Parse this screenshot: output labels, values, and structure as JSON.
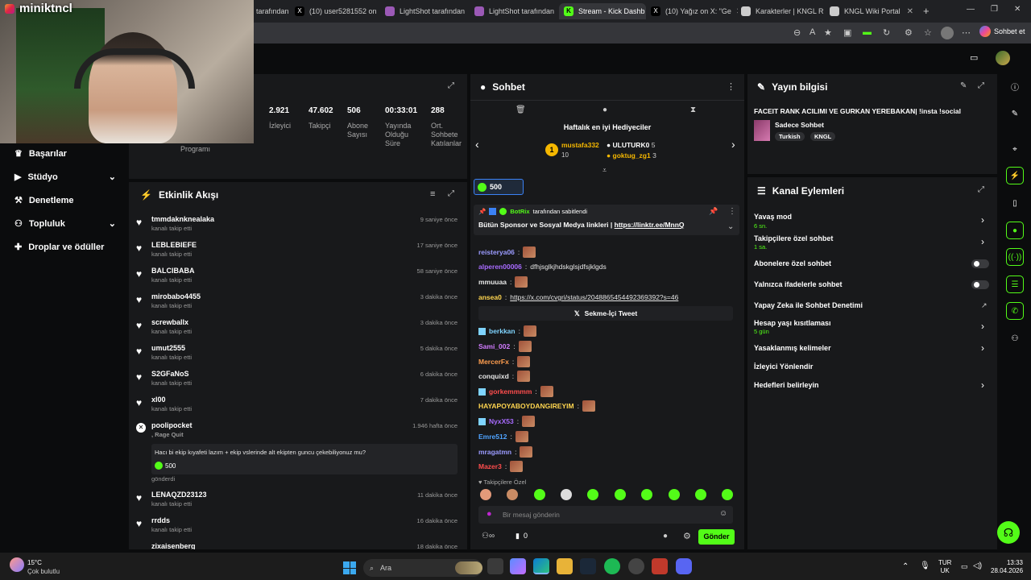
{
  "browser": {
    "tabs": [
      {
        "label": "tarafından",
        "active": false
      },
      {
        "label": "(10) user5281552 on",
        "active": false
      },
      {
        "label": "LightShot tarafından",
        "active": false
      },
      {
        "label": "LightShot tarafından",
        "active": false
      },
      {
        "label": "Stream - Kick Dashb",
        "active": true
      },
      {
        "label": "(10) Yağız on X: \"Ge",
        "active": false
      },
      {
        "label": "Karakterler | KNGL R",
        "active": false
      },
      {
        "label": "KNGL Wiki Portal",
        "active": false
      }
    ],
    "chat_button": "Sohbet et"
  },
  "webcam": {
    "username": "miniktncl"
  },
  "sidebar": {
    "items": [
      {
        "label": "Başarılar",
        "icon": "trophy-icon"
      },
      {
        "label": "Stüdyo",
        "icon": "video-icon",
        "expandable": true
      },
      {
        "label": "Denetleme",
        "icon": "hammer-icon"
      },
      {
        "label": "Topluluk",
        "icon": "people-icon",
        "expandable": true
      },
      {
        "label": "Droplar ve ödüller",
        "icon": "gift-icon"
      }
    ]
  },
  "stats": {
    "partial_label": "Programı",
    "items": [
      {
        "value": "2.921",
        "label": "İzleyici"
      },
      {
        "value": "47.602",
        "label": "Takipçi"
      },
      {
        "value": "506",
        "label": "Abone Sayısı"
      },
      {
        "value": "00:33:01",
        "label": "Yayında Olduğu Süre"
      },
      {
        "value": "288",
        "label": "Ort. Sohbete Katılanlar"
      }
    ]
  },
  "activity": {
    "title": "Etkinlik Akışı",
    "events": [
      {
        "name": "tmmdaknknealaka",
        "sub": "kanalı takip etti",
        "time": "9 saniye önce"
      },
      {
        "name": "LEBLEBIEFE",
        "sub": "kanalı takip etti",
        "time": "17 saniye önce"
      },
      {
        "name": "BALCIBABA",
        "sub": "kanalı takip etti",
        "time": "58 saniye önce"
      },
      {
        "name": "mirobabo4455",
        "sub": "kanalı takip etti",
        "time": "3 dakika önce"
      },
      {
        "name": "screwballx",
        "sub": "kanalı takip etti",
        "time": "3 dakika önce"
      },
      {
        "name": "umut2555",
        "sub": "kanalı takip etti",
        "time": "5 dakika önce"
      },
      {
        "name": "S2GFaNoS",
        "sub": "kanalı takip etti",
        "time": "6 dakika önce"
      },
      {
        "name": "xl00",
        "sub": "kanalı takip etti",
        "time": "7 dakika önce"
      }
    ],
    "gift": {
      "name": "poolipocket",
      "sub": ", Rage Quit",
      "time": "1.946 hafta önce",
      "message": "Hacı bi ekip kıyafeti lazım + ekip vslerinde alt ekipten guncu çekebiliyonuz mu?",
      "amount": "500",
      "footer": "gönderdi"
    },
    "events2": [
      {
        "name": "LENAQZD23123",
        "sub": "kanalı takip etti",
        "time": "11 dakika önce"
      },
      {
        "name": "rrdds",
        "sub": "kanalı takip etti",
        "time": "16 dakika önce"
      },
      {
        "name": "zixaisenberg",
        "sub": "",
        "time": "18 dakika önce"
      }
    ]
  },
  "chat": {
    "title": "Sohbet",
    "gifters_title": "Haftalık en iyi Hediyeciler",
    "gifters": [
      {
        "name": "mustafa332",
        "count": "10"
      },
      {
        "name": "ULUTURK0",
        "count": "5"
      },
      {
        "name": "goktug_zg1",
        "count": "3"
      }
    ],
    "kicks_badge": "500",
    "pinned": {
      "by": "BotRix",
      "by_suffix": "tarafından sabitlendi",
      "text": "Bütün Sponsor ve Sosyal Medya linkleri |",
      "link": "https://linktr.ee/MnnQ"
    },
    "messages": [
      {
        "user": "reisterya06",
        "color": "#9b9bff",
        "text": ""
      },
      {
        "user": "alperen00006",
        "color": "#a86bff",
        "text": "dfhjsglkjhdskglsjdfsjklgds"
      },
      {
        "user": "mmuuaa",
        "color": "#e6e6e6",
        "text": ""
      },
      {
        "user": "ansea0",
        "color": "#ffd54f",
        "text": "https://x.com/cvgri/status/2048865454492369392?s=46"
      }
    ],
    "tweet_label": "Sekme-İçi Tweet",
    "messages2": [
      {
        "user": "berkkan",
        "color": "#7fd4ff"
      },
      {
        "user": "Sami_002",
        "color": "#d17bff"
      },
      {
        "user": "MercerFx",
        "color": "#ff9e4f"
      },
      {
        "user": "conquixd",
        "color": "#e6e6e6"
      },
      {
        "user": "gorkemmmm",
        "color": "#ff4d4d"
      },
      {
        "user": "HAYAPOYABOYDANGIREYIM",
        "color": "#ffd54f"
      },
      {
        "user": "NyxX53",
        "color": "#a86bff"
      },
      {
        "user": "Emre512",
        "color": "#4fa3ff"
      },
      {
        "user": "mragatmn",
        "color": "#9b9bff"
      },
      {
        "user": "Mazer3",
        "color": "#ff4d4d"
      }
    ],
    "followers_only": "Takipçilere Özel",
    "input_placeholder": "Bir mesaj gönderin",
    "points": "0",
    "send_label": "Gönder"
  },
  "stream_info": {
    "title": "Yayın bilgisi",
    "stream_title": "FACEIT RANK ACILIMI VE GURKAN YEREBAKAN| !insta !social",
    "category": "Sadece Sohbet",
    "tags": [
      "Turkish",
      "KNGL"
    ]
  },
  "channel_actions": {
    "title": "Kanal Eylemleri",
    "items": [
      {
        "label": "Yavaş mod",
        "sub": "6 sn.",
        "control": "chevron"
      },
      {
        "label": "Takipçilere özel sohbet",
        "sub": "1 sa.",
        "control": "chevron"
      },
      {
        "label": "Abonelere özel sohbet",
        "sub": "",
        "control": "toggle"
      },
      {
        "label": "Yalnızca ifadelerle sohbet",
        "sub": "",
        "control": "toggle"
      },
      {
        "label": "Yapay Zeka ile Sohbet Denetimi",
        "sub": "",
        "control": "external"
      },
      {
        "label": "Hesap yaşı kısıtlaması",
        "sub": "5 gün",
        "control": "chevron"
      },
      {
        "label": "Yasaklanmış kelimeler",
        "sub": "",
        "control": "chevron"
      },
      {
        "label": "İzleyici Yönlendir",
        "sub": "",
        "control": "none"
      },
      {
        "label": "Hedefleri belirleyin",
        "sub": "",
        "control": "chevron"
      }
    ]
  },
  "taskbar": {
    "weather_temp": "15°C",
    "weather_desc": "Çok bulutlu",
    "search_label": "Ara",
    "lang_top": "TUR",
    "lang_bottom": "UK",
    "time": "13:33",
    "date": "28.04.2026"
  },
  "colors": {
    "kick_green": "#53fc18",
    "panel": "#18191b",
    "bg": "#0b0c0d"
  }
}
